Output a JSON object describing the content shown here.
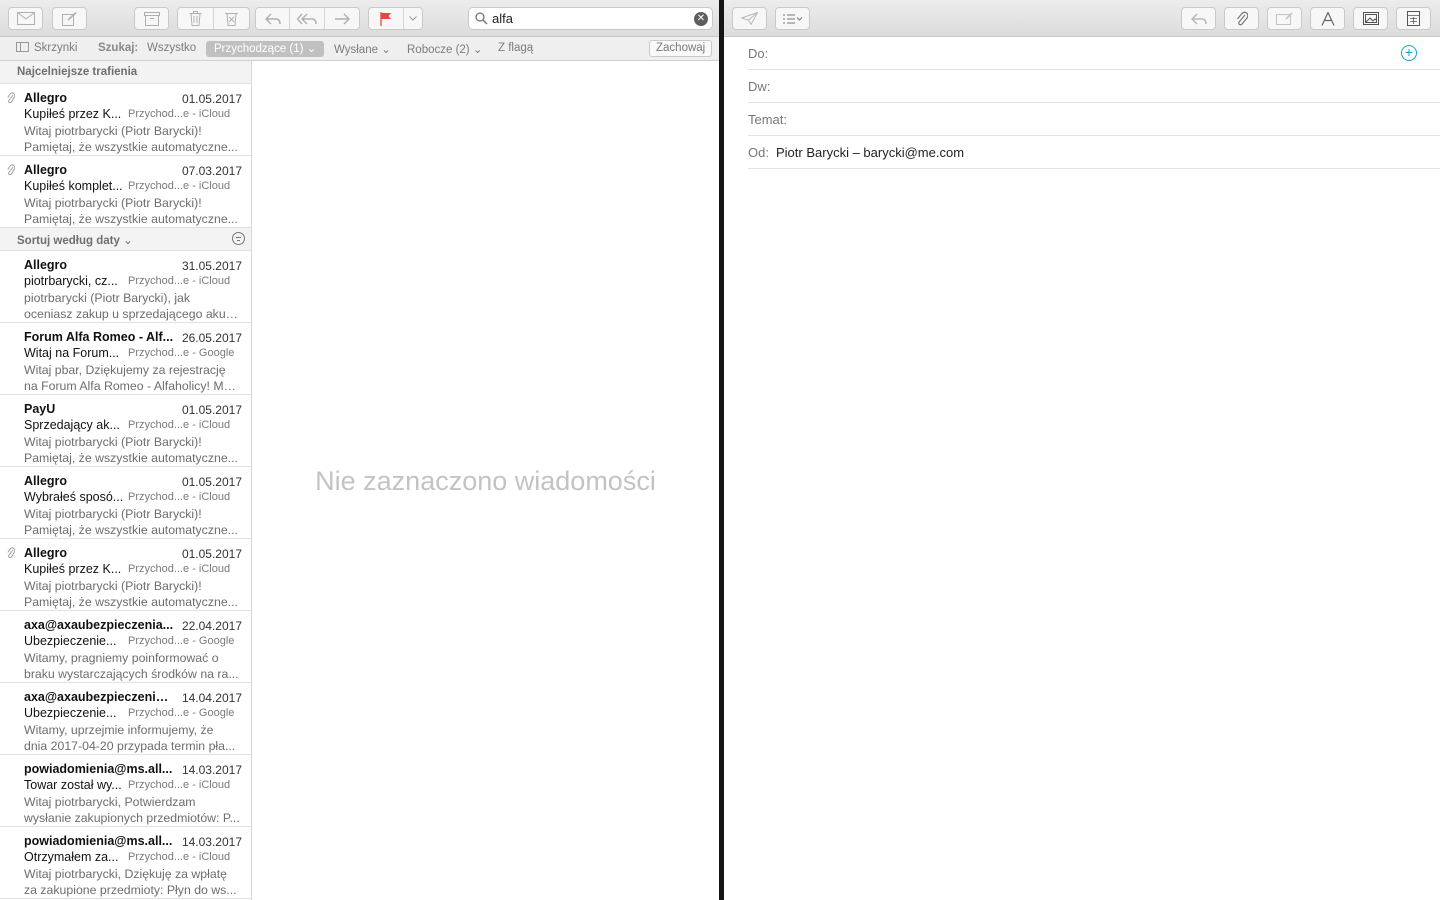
{
  "left_window": {
    "search": {
      "value": "alfa"
    },
    "scope": {
      "mailboxes": "Skrzynki",
      "search_label": "Szukaj:",
      "all": "Wszystko",
      "inbox": "Przychodzące (1)",
      "sent": "Wysłane",
      "drafts": "Robocze (2)",
      "flagged": "Z flagą",
      "save": "Zachowaj"
    },
    "top_hits_title": "Najcelniejsze trafienia",
    "sort_label": "Sortuj według daty",
    "top_hits": [
      {
        "from": "Allegro",
        "date": "01.05.2017",
        "subject": "Kupiłeś przez K...",
        "mailbox": "Przychod...e - iCloud",
        "preview1": "Witaj piotrbarycki (Piotr Barycki)!",
        "preview2": "Pamiętaj, że wszystkie automatyczne..."
      },
      {
        "from": "Allegro",
        "date": "07.03.2017",
        "subject": "Kupiłeś komplet...",
        "mailbox": "Przychod...e - iCloud",
        "preview1": "Witaj piotrbarycki (Piotr Barycki)!",
        "preview2": "Pamiętaj, że wszystkie automatyczne..."
      }
    ],
    "messages": [
      {
        "from": "Allegro",
        "date": "31.05.2017",
        "subject": "piotrbarycki, cz...",
        "mailbox": "Przychod...e - iCloud",
        "preview1": "piotrbarycki (Piotr Barycki), jak",
        "preview2": "oceniasz zakup u sprzedającego akuk..."
      },
      {
        "from": "Forum Alfa Romeo - Alf...",
        "date": "26.05.2017",
        "subject": "Witaj na Forum...",
        "mailbox": "Przychod...e - Google",
        "preview1": "Witaj pbar, Dziękujemy za rejestrację",
        "preview2": "na Forum Alfa Romeo - Alfaholicy! Ma..."
      },
      {
        "from": "PayU",
        "date": "01.05.2017",
        "subject": "Sprzedający ak...",
        "mailbox": "Przychod...e - iCloud",
        "preview1": "Witaj piotrbarycki (Piotr Barycki)!",
        "preview2": "Pamiętaj, że wszystkie automatyczne..."
      },
      {
        "from": "Allegro",
        "date": "01.05.2017",
        "subject": "Wybrałeś sposó...",
        "mailbox": "Przychod...e - iCloud",
        "preview1": "Witaj piotrbarycki (Piotr Barycki)!",
        "preview2": "Pamiętaj, że wszystkie automatyczne..."
      },
      {
        "from": "Allegro",
        "date": "01.05.2017",
        "subject": "Kupiłeś przez K...",
        "mailbox": "Przychod...e - iCloud",
        "preview1": "Witaj piotrbarycki (Piotr Barycki)!",
        "preview2": "Pamiętaj, że wszystkie automatyczne..."
      },
      {
        "from": "axa@axaubezpieczenia...",
        "date": "22.04.2017",
        "subject": "Ubezpieczenie...",
        "mailbox": "Przychod...e - Google",
        "preview1": "Witamy, pragniemy poinformować o",
        "preview2": "braku wystarczających środków na ra..."
      },
      {
        "from": "axa@axaubezpieczenia....",
        "date": "14.04.2017",
        "subject": "Ubezpieczenie...",
        "mailbox": "Przychod...e - Google",
        "preview1": "Witamy, uprzejmie informujemy, że",
        "preview2": "dnia 2017-04-20 przypada termin pła..."
      },
      {
        "from": "powiadomienia@ms.all...",
        "date": "14.03.2017",
        "subject": "Towar został wy...",
        "mailbox": "Przychod...e - iCloud",
        "preview1": "Witaj piotrbarycki, Potwierdzam",
        "preview2": "wysłanie zakupionych przedmiotów: P..."
      },
      {
        "from": "powiadomienia@ms.all...",
        "date": "14.03.2017",
        "subject": "Otrzymałem za...",
        "mailbox": "Przychod...e - iCloud",
        "preview1": "Witaj piotrbarycki, Dziękuję za wpłatę",
        "preview2": "za zakupione przedmioty: Płyn do ws..."
      }
    ],
    "no_selection": "Nie zaznaczono wiadomości"
  },
  "compose": {
    "to_label": "Do:",
    "cc_label": "Dw:",
    "subject_label": "Temat:",
    "from_label": "Od:",
    "from_value": "Piotr Barycki – barycki@me.com"
  },
  "colors": {
    "accent": "#1e9bd7",
    "flag": "#e9463f"
  },
  "icons": [
    "mail-icon",
    "compose-icon",
    "archive-icon",
    "trash-icon",
    "junk-icon",
    "reply-icon",
    "reply-all-icon",
    "forward-icon",
    "flag-icon",
    "search-icon",
    "paperclip-icon",
    "send-icon",
    "list-icon",
    "font-icon",
    "photo-icon",
    "grid-icon"
  ]
}
